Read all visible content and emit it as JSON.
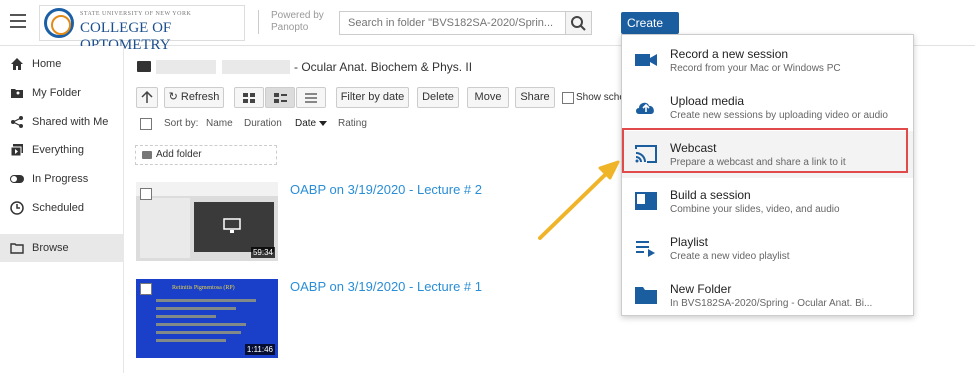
{
  "header": {
    "logo_small": "STATE UNIVERSITY OF NEW YORK",
    "logo_big": "COLLEGE OF OPTOMETRY",
    "powered_by": "Powered by",
    "powered_brand": "Panopto",
    "search_placeholder": "Search in folder \"BVS182SA-2020/Sprin...",
    "create_label": "Create"
  },
  "sidebar": {
    "items": [
      {
        "label": "Home",
        "icon": "home-icon"
      },
      {
        "label": "My Folder",
        "icon": "user-folder-icon"
      },
      {
        "label": "Shared with Me",
        "icon": "share-icon"
      },
      {
        "label": "Everything",
        "icon": "stack-icon"
      },
      {
        "label": "In Progress",
        "icon": "toggle-icon"
      },
      {
        "label": "Scheduled",
        "icon": "clock-icon"
      },
      {
        "label": "Browse",
        "icon": "folder-icon"
      }
    ]
  },
  "main": {
    "folder_title": "- Ocular Anat. Biochem & Phys. II",
    "toolbar": {
      "refresh": "Refresh",
      "filter_by_date": "Filter by date",
      "delete": "Delete",
      "move": "Move",
      "share": "Share",
      "show_sched": "Show sched"
    },
    "sort": {
      "label": "Sort by:",
      "name": "Name",
      "duration": "Duration",
      "date": "Date",
      "rating": "Rating"
    },
    "add_folder": "Add folder",
    "sessions": [
      {
        "title": "OABP on 3/19/2020 - Lecture # 2",
        "duration": "59:34"
      },
      {
        "title": "OABP on 3/19/2020 - Lecture # 1",
        "duration": "1:11:46",
        "slide_title": "Retinitis Pigmentosa (RP)"
      }
    ]
  },
  "create_menu": {
    "items": [
      {
        "title": "Record a new session",
        "subtitle": "Record from your Mac or Windows PC",
        "icon": "video-camera-icon"
      },
      {
        "title": "Upload media",
        "subtitle": "Create new sessions by uploading video or audio",
        "icon": "cloud-upload-icon"
      },
      {
        "title": "Webcast",
        "subtitle": "Prepare a webcast and share a link to it",
        "icon": "cast-icon"
      },
      {
        "title": "Build a session",
        "subtitle": "Combine your slides, video, and audio",
        "icon": "build-session-icon"
      },
      {
        "title": "Playlist",
        "subtitle": "Create a new video playlist",
        "icon": "playlist-icon"
      },
      {
        "title": "New Folder",
        "subtitle": "In BVS182SA-2020/Spring - Ocular Anat. Bi...",
        "icon": "new-folder-icon"
      }
    ]
  },
  "colors": {
    "accent": "#1b5e9f",
    "link": "#2a8ed6",
    "highlight": "#e04a4a",
    "arrow": "#f0b429"
  }
}
